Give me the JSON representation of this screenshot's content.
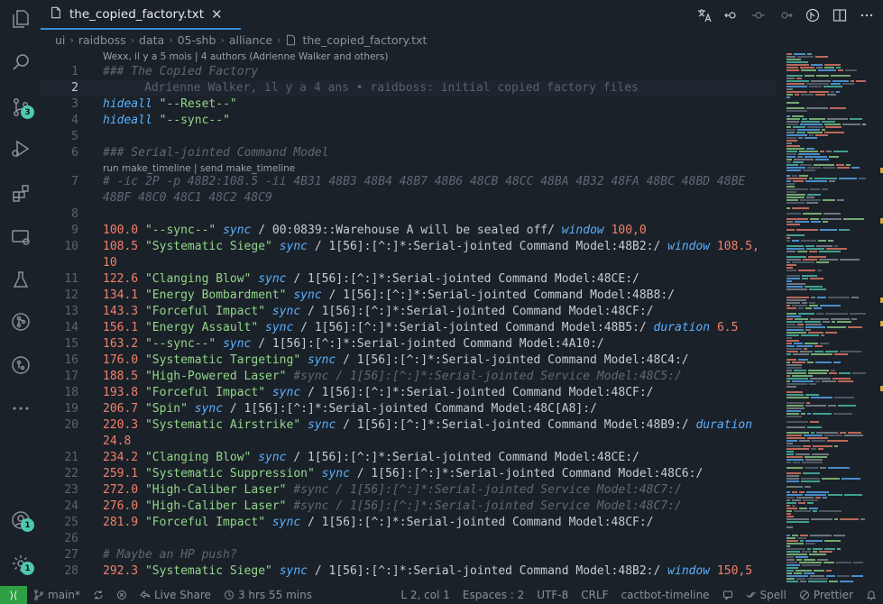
{
  "tab": {
    "label": "the_copied_factory.txt",
    "close": "✕"
  },
  "breadcrumb": [
    "ui",
    "raidboss",
    "data",
    "05-shb",
    "alliance",
    "the_copied_factory.txt"
  ],
  "codelens": {
    "authors": "Wexx, il y a 5 mois | 4 authors (Adrienne Walker and others)",
    "timeline": "run make_timeline | send make_timeline"
  },
  "blame": "Adrienne Walker, il y a 4 ans • raidboss: initial copied factory files",
  "activity_badges": {
    "source_control": "3",
    "accounts": "1",
    "settings": "1"
  },
  "lines": [
    {
      "n": "1",
      "tokens": [
        [
          "c-comment",
          "### The Copied Factory"
        ]
      ]
    },
    {
      "n": "2",
      "tokens": []
    },
    {
      "n": "3",
      "tokens": [
        [
          "c-kw",
          "hideall"
        ],
        [
          "c-plain",
          " "
        ],
        [
          "c-str",
          "\"--Reset--\""
        ]
      ]
    },
    {
      "n": "4",
      "tokens": [
        [
          "c-kw",
          "hideall"
        ],
        [
          "c-plain",
          " "
        ],
        [
          "c-str",
          "\"--sync--\""
        ]
      ]
    },
    {
      "n": "5",
      "tokens": []
    },
    {
      "n": "6",
      "tokens": [
        [
          "c-comment",
          "### Serial-jointed Command Model"
        ]
      ]
    },
    {
      "n": "7",
      "tokens": [
        [
          "c-comment",
          "# -ic 2P -p 48B2:108.5 -ii 4B31 48B3 48B4 48B7 48B6 48CB 48CC 48BA 4B32 48FA 48BC 48BD 48BE"
        ]
      ]
    },
    {
      "n": "",
      "tokens": [
        [
          "c-comment",
          "48BF 48C0 48C1 48C2 48C9"
        ]
      ]
    },
    {
      "n": "8",
      "tokens": []
    },
    {
      "n": "9",
      "tokens": [
        [
          "c-num",
          "100.0"
        ],
        [
          "c-plain",
          " "
        ],
        [
          "c-str",
          "\"--sync--\""
        ],
        [
          "c-plain",
          " "
        ],
        [
          "c-kw",
          "sync"
        ],
        [
          "c-plain",
          " / 00:0839::Warehouse A will be sealed off/ "
        ],
        [
          "c-kw",
          "window"
        ],
        [
          "c-plain",
          " "
        ],
        [
          "c-num",
          "100,0"
        ]
      ]
    },
    {
      "n": "10",
      "tokens": [
        [
          "c-num",
          "108.5"
        ],
        [
          "c-plain",
          " "
        ],
        [
          "c-str",
          "\"Systematic Siege\""
        ],
        [
          "c-plain",
          " "
        ],
        [
          "c-kw",
          "sync"
        ],
        [
          "c-plain",
          " / 1[56]:[^:]*:Serial-jointed Command Model:48B2:/ "
        ],
        [
          "c-kw",
          "window"
        ],
        [
          "c-plain",
          " "
        ],
        [
          "c-num",
          "108.5,"
        ]
      ]
    },
    {
      "n": "",
      "tokens": [
        [
          "c-num",
          "10"
        ]
      ]
    },
    {
      "n": "11",
      "tokens": [
        [
          "c-num",
          "122.6"
        ],
        [
          "c-plain",
          " "
        ],
        [
          "c-str",
          "\"Clanging Blow\""
        ],
        [
          "c-plain",
          " "
        ],
        [
          "c-kw",
          "sync"
        ],
        [
          "c-plain",
          " / 1[56]:[^:]*:Serial-jointed Command Model:48CE:/"
        ]
      ]
    },
    {
      "n": "12",
      "tokens": [
        [
          "c-num",
          "134.1"
        ],
        [
          "c-plain",
          " "
        ],
        [
          "c-str",
          "\"Energy Bombardment\""
        ],
        [
          "c-plain",
          " "
        ],
        [
          "c-kw",
          "sync"
        ],
        [
          "c-plain",
          " / 1[56]:[^:]*:Serial-jointed Command Model:48B8:/"
        ]
      ]
    },
    {
      "n": "13",
      "tokens": [
        [
          "c-num",
          "143.3"
        ],
        [
          "c-plain",
          " "
        ],
        [
          "c-str",
          "\"Forceful Impact\""
        ],
        [
          "c-plain",
          " "
        ],
        [
          "c-kw",
          "sync"
        ],
        [
          "c-plain",
          " / 1[56]:[^:]*:Serial-jointed Command Model:48CF:/"
        ]
      ]
    },
    {
      "n": "14",
      "tokens": [
        [
          "c-num",
          "156.1"
        ],
        [
          "c-plain",
          " "
        ],
        [
          "c-str",
          "\"Energy Assault\""
        ],
        [
          "c-plain",
          " "
        ],
        [
          "c-kw",
          "sync"
        ],
        [
          "c-plain",
          " / 1[56]:[^:]*:Serial-jointed Command Model:48B5:/ "
        ],
        [
          "c-kw",
          "duration"
        ],
        [
          "c-plain",
          " "
        ],
        [
          "c-num",
          "6.5"
        ]
      ]
    },
    {
      "n": "15",
      "tokens": [
        [
          "c-num",
          "163.2"
        ],
        [
          "c-plain",
          " "
        ],
        [
          "c-str",
          "\"--sync--\""
        ],
        [
          "c-plain",
          " "
        ],
        [
          "c-kw",
          "sync"
        ],
        [
          "c-plain",
          " / 1[56]:[^:]*:Serial-jointed Command Model:4A10:/"
        ]
      ]
    },
    {
      "n": "16",
      "tokens": [
        [
          "c-num",
          "176.0"
        ],
        [
          "c-plain",
          " "
        ],
        [
          "c-str",
          "\"Systematic Targeting\""
        ],
        [
          "c-plain",
          " "
        ],
        [
          "c-kw",
          "sync"
        ],
        [
          "c-plain",
          " / 1[56]:[^:]*:Serial-jointed Command Model:48C4:/"
        ]
      ]
    },
    {
      "n": "17",
      "tokens": [
        [
          "c-num",
          "188.5"
        ],
        [
          "c-plain",
          " "
        ],
        [
          "c-str",
          "\"High-Powered Laser\""
        ],
        [
          "c-plain",
          " "
        ],
        [
          "c-comment",
          "#sync / 1[56]:[^:]*:Serial-jointed Service Model:48C5:/"
        ]
      ]
    },
    {
      "n": "18",
      "tokens": [
        [
          "c-num",
          "193.8"
        ],
        [
          "c-plain",
          " "
        ],
        [
          "c-str",
          "\"Forceful Impact\""
        ],
        [
          "c-plain",
          " "
        ],
        [
          "c-kw",
          "sync"
        ],
        [
          "c-plain",
          " / 1[56]:[^:]*:Serial-jointed Command Model:48CF:/"
        ]
      ]
    },
    {
      "n": "19",
      "tokens": [
        [
          "c-num",
          "206.7"
        ],
        [
          "c-plain",
          " "
        ],
        [
          "c-str",
          "\"Spin\""
        ],
        [
          "c-plain",
          " "
        ],
        [
          "c-kw",
          "sync"
        ],
        [
          "c-plain",
          " / 1[56]:[^:]*:Serial-jointed Command Model:48C[A8]:/"
        ]
      ]
    },
    {
      "n": "20",
      "tokens": [
        [
          "c-num",
          "220.3"
        ],
        [
          "c-plain",
          " "
        ],
        [
          "c-str",
          "\"Systematic Airstrike\""
        ],
        [
          "c-plain",
          " "
        ],
        [
          "c-kw",
          "sync"
        ],
        [
          "c-plain",
          " / 1[56]:[^:]*:Serial-jointed Command Model:48B9:/ "
        ],
        [
          "c-kw",
          "duration"
        ]
      ]
    },
    {
      "n": "",
      "tokens": [
        [
          "c-num",
          "24.8"
        ]
      ]
    },
    {
      "n": "21",
      "tokens": [
        [
          "c-num",
          "234.2"
        ],
        [
          "c-plain",
          " "
        ],
        [
          "c-str",
          "\"Clanging Blow\""
        ],
        [
          "c-plain",
          " "
        ],
        [
          "c-kw",
          "sync"
        ],
        [
          "c-plain",
          " / 1[56]:[^:]*:Serial-jointed Command Model:48CE:/"
        ]
      ]
    },
    {
      "n": "22",
      "tokens": [
        [
          "c-num",
          "259.1"
        ],
        [
          "c-plain",
          " "
        ],
        [
          "c-str",
          "\"Systematic Suppression\""
        ],
        [
          "c-plain",
          " "
        ],
        [
          "c-kw",
          "sync"
        ],
        [
          "c-plain",
          " / 1[56]:[^:]*:Serial-jointed Command Model:48C6:/"
        ]
      ]
    },
    {
      "n": "23",
      "tokens": [
        [
          "c-num",
          "272.0"
        ],
        [
          "c-plain",
          " "
        ],
        [
          "c-str",
          "\"High-Caliber Laser\""
        ],
        [
          "c-plain",
          " "
        ],
        [
          "c-comment",
          "#sync / 1[56]:[^:]*:Serial-jointed Service Model:48C7:/"
        ]
      ]
    },
    {
      "n": "24",
      "tokens": [
        [
          "c-num",
          "276.0"
        ],
        [
          "c-plain",
          " "
        ],
        [
          "c-str",
          "\"High-Caliber Laser\""
        ],
        [
          "c-plain",
          " "
        ],
        [
          "c-comment",
          "#sync / 1[56]:[^:]*:Serial-jointed Service Model:48C7:/"
        ]
      ]
    },
    {
      "n": "25",
      "tokens": [
        [
          "c-num",
          "281.9"
        ],
        [
          "c-plain",
          " "
        ],
        [
          "c-str",
          "\"Forceful Impact\""
        ],
        [
          "c-plain",
          " "
        ],
        [
          "c-kw",
          "sync"
        ],
        [
          "c-plain",
          " / 1[56]:[^:]*:Serial-jointed Command Model:48CF:/"
        ]
      ]
    },
    {
      "n": "26",
      "tokens": []
    },
    {
      "n": "27",
      "tokens": [
        [
          "c-comment",
          "# Maybe an HP push?"
        ]
      ]
    },
    {
      "n": "28",
      "tokens": [
        [
          "c-num",
          "292.3"
        ],
        [
          "c-plain",
          " "
        ],
        [
          "c-str",
          "\"Systematic Siege\""
        ],
        [
          "c-plain",
          " "
        ],
        [
          "c-kw",
          "sync"
        ],
        [
          "c-plain",
          " / 1[56]:[^:]*:Serial-jointed Command Model:48B2:/ "
        ],
        [
          "c-kw",
          "window"
        ],
        [
          "c-plain",
          " "
        ],
        [
          "c-num",
          "150,5"
        ]
      ]
    }
  ],
  "statusbar": {
    "remote": "⟩⟨",
    "branch": "main*",
    "sync": "",
    "errors": "",
    "live_share": "Live Share",
    "time": "3 hrs 55 mins",
    "position": "L 2, col 1",
    "spaces": "Espaces : 2",
    "encoding": "UTF-8",
    "eol": "CRLF",
    "language": "cactbot-timeline",
    "spell": "Spell",
    "prettier": "Prettier"
  },
  "colors": {
    "accent": "#3a8bd8",
    "badge": "#4ec9b0",
    "number": "#f0806a",
    "string": "#92d68a",
    "keyword": "#5ab0ff",
    "comment": "#5f6873"
  }
}
